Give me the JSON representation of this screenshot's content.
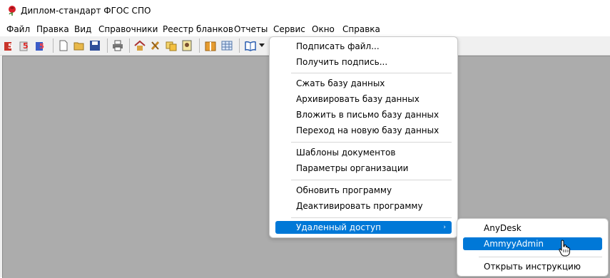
{
  "window": {
    "title": "Диплом-стандарт ФГОС СПО",
    "icon": "rose-logo-icon"
  },
  "menubar": [
    {
      "label": "Файл"
    },
    {
      "label": "Правка"
    },
    {
      "label": "Вид"
    },
    {
      "label": "Справочники"
    },
    {
      "label": "Реестр бланков"
    },
    {
      "label": "Отчеты"
    },
    {
      "label": "Сервис"
    },
    {
      "label": "Окно"
    },
    {
      "label": "Справка"
    }
  ],
  "toolbar": {
    "icons": [
      "diploma-red-5-icon",
      "diploma-red-5b-icon",
      "diploma-blue-5-icon",
      "new-document-icon",
      "open-folder-icon",
      "save-disk-icon",
      "print-icon",
      "home-icon",
      "tools-icon",
      "copy-icon",
      "report-icon",
      "package-icon",
      "table-grid-icon",
      "book-icon",
      "dropdown-arrow-icon"
    ]
  },
  "service_menu": {
    "groups": [
      [
        "Подписать файл...",
        "Получить подпись..."
      ],
      [
        "Сжать базу данных",
        "Архивировать базу данных",
        "Вложить в письмо базу данных",
        "Переход на новую базу данных"
      ],
      [
        "Шаблоны документов",
        "Параметры организации"
      ],
      [
        "Обновить программу",
        "Деактивировать программу"
      ]
    ],
    "remote_access": "Удаленный доступ",
    "remote_arrow": "›"
  },
  "remote_submenu": {
    "items": [
      "AnyDesk",
      "AmmyyAdmin"
    ],
    "instruction": "Открыть инструкцию",
    "selected": "AmmyyAdmin"
  },
  "colors": {
    "highlight": "#0078d7",
    "workspace": "#acacac"
  }
}
